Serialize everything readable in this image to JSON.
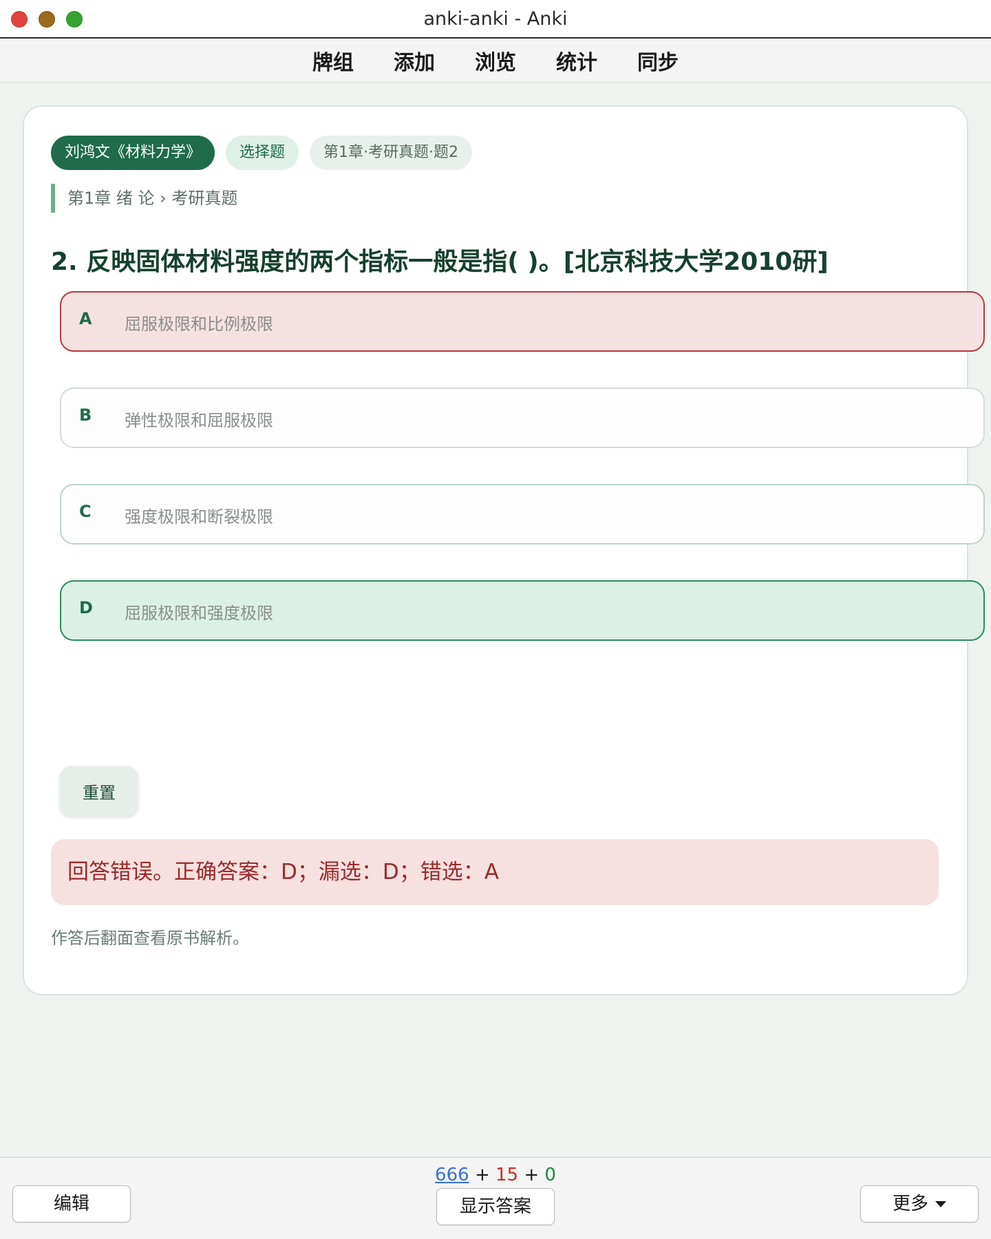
{
  "window": {
    "title": "anki-anki - Anki"
  },
  "topnav": {
    "items": [
      "牌组",
      "添加",
      "浏览",
      "统计",
      "同步"
    ]
  },
  "card": {
    "tags": [
      "刘鸿文《材料力学》",
      "选择题",
      "第1章·考研真题·题2"
    ],
    "breadcrumb": "第1章 绪 论 › 考研真题",
    "question": "2. 反映固体材料强度的两个指标一般是指( )。[北京科技大学2010研]",
    "options": [
      {
        "letter": "A",
        "text": "屈服极限和比例极限",
        "state": "wrong"
      },
      {
        "letter": "B",
        "text": "弹性极限和屈服极限",
        "state": "default"
      },
      {
        "letter": "C",
        "text": "强度极限和断裂极限",
        "state": "default"
      },
      {
        "letter": "D",
        "text": "屈服极限和强度极限",
        "state": "correct"
      }
    ],
    "reset_label": "重置",
    "feedback": "回答错误。正确答案：D；漏选：D；错选：A",
    "hint": "作答后翻面查看原书解析。"
  },
  "bottombar": {
    "counts": {
      "new": "666",
      "learn": "15",
      "review": "0",
      "sep": "+"
    },
    "edit_label": "编辑",
    "show_answer_label": "显示答案",
    "more_label": "更多"
  },
  "colors": {
    "accent": "#1f6b4b",
    "wrong_bg": "#f6e1e1",
    "correct_bg": "#dbf1e5",
    "new_count": "#3a6fd8",
    "learn_count": "#cc2d2d",
    "review_count": "#1f8a3b"
  }
}
